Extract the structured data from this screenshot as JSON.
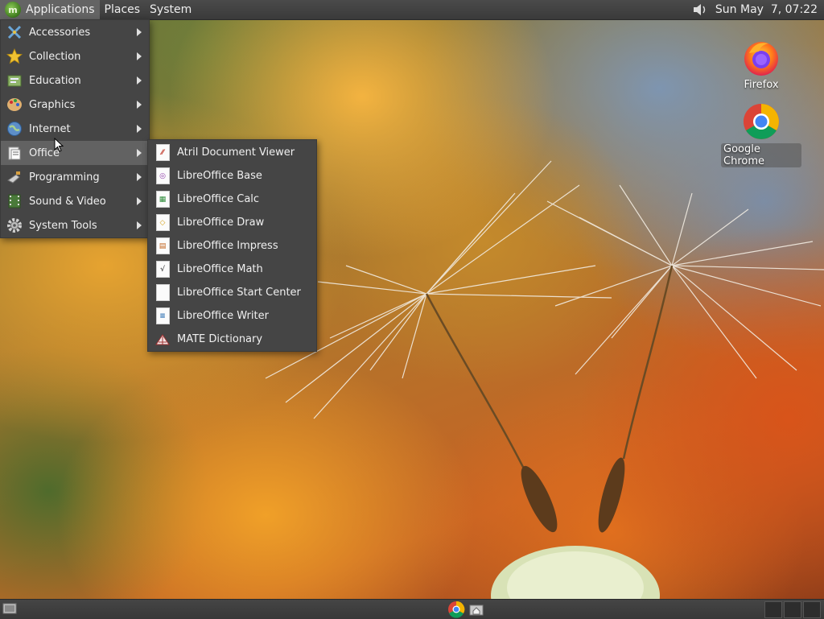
{
  "top_panel": {
    "menus": [
      {
        "label": "Applications"
      },
      {
        "label": "Places"
      },
      {
        "label": "System"
      }
    ],
    "clock": "Sun May  7, 07:22",
    "volume_icon": "speaker-icon"
  },
  "applications_menu": {
    "items": [
      {
        "label": "Accessories",
        "icon": "accessories-icon"
      },
      {
        "label": "Collection",
        "icon": "star-icon"
      },
      {
        "label": "Education",
        "icon": "education-icon"
      },
      {
        "label": "Graphics",
        "icon": "graphics-icon"
      },
      {
        "label": "Internet",
        "icon": "globe-icon"
      },
      {
        "label": "Office",
        "icon": "office-icon",
        "active": true
      },
      {
        "label": "Programming",
        "icon": "programming-icon"
      },
      {
        "label": "Sound & Video",
        "icon": "film-icon"
      },
      {
        "label": "System Tools",
        "icon": "gear-icon"
      }
    ]
  },
  "office_submenu": {
    "items": [
      {
        "label": "Atril Document Viewer",
        "icon": "atril-icon"
      },
      {
        "label": "LibreOffice Base",
        "icon": "libreoffice-base-icon"
      },
      {
        "label": "LibreOffice Calc",
        "icon": "libreoffice-calc-icon"
      },
      {
        "label": "LibreOffice Draw",
        "icon": "libreoffice-draw-icon"
      },
      {
        "label": "LibreOffice Impress",
        "icon": "libreoffice-impress-icon"
      },
      {
        "label": "LibreOffice Math",
        "icon": "libreoffice-math-icon"
      },
      {
        "label": "LibreOffice Start Center",
        "icon": "libreoffice-start-center-icon"
      },
      {
        "label": "LibreOffice Writer",
        "icon": "libreoffice-writer-icon"
      },
      {
        "label": "MATE Dictionary",
        "icon": "dictionary-icon"
      }
    ]
  },
  "desktop_icons": [
    {
      "label": "Firefox",
      "icon": "firefox-icon"
    },
    {
      "label": "Google Chrome",
      "icon": "chrome-icon"
    }
  ],
  "bottom_panel": {
    "launchers": [
      "chrome-icon",
      "home-folder-icon"
    ],
    "workspace_count": 3
  },
  "colors": {
    "panel": "#3a3a3a",
    "menu_bg": "#454545",
    "menu_highlight": "#626262",
    "mate_green": "#3d7a1c"
  }
}
